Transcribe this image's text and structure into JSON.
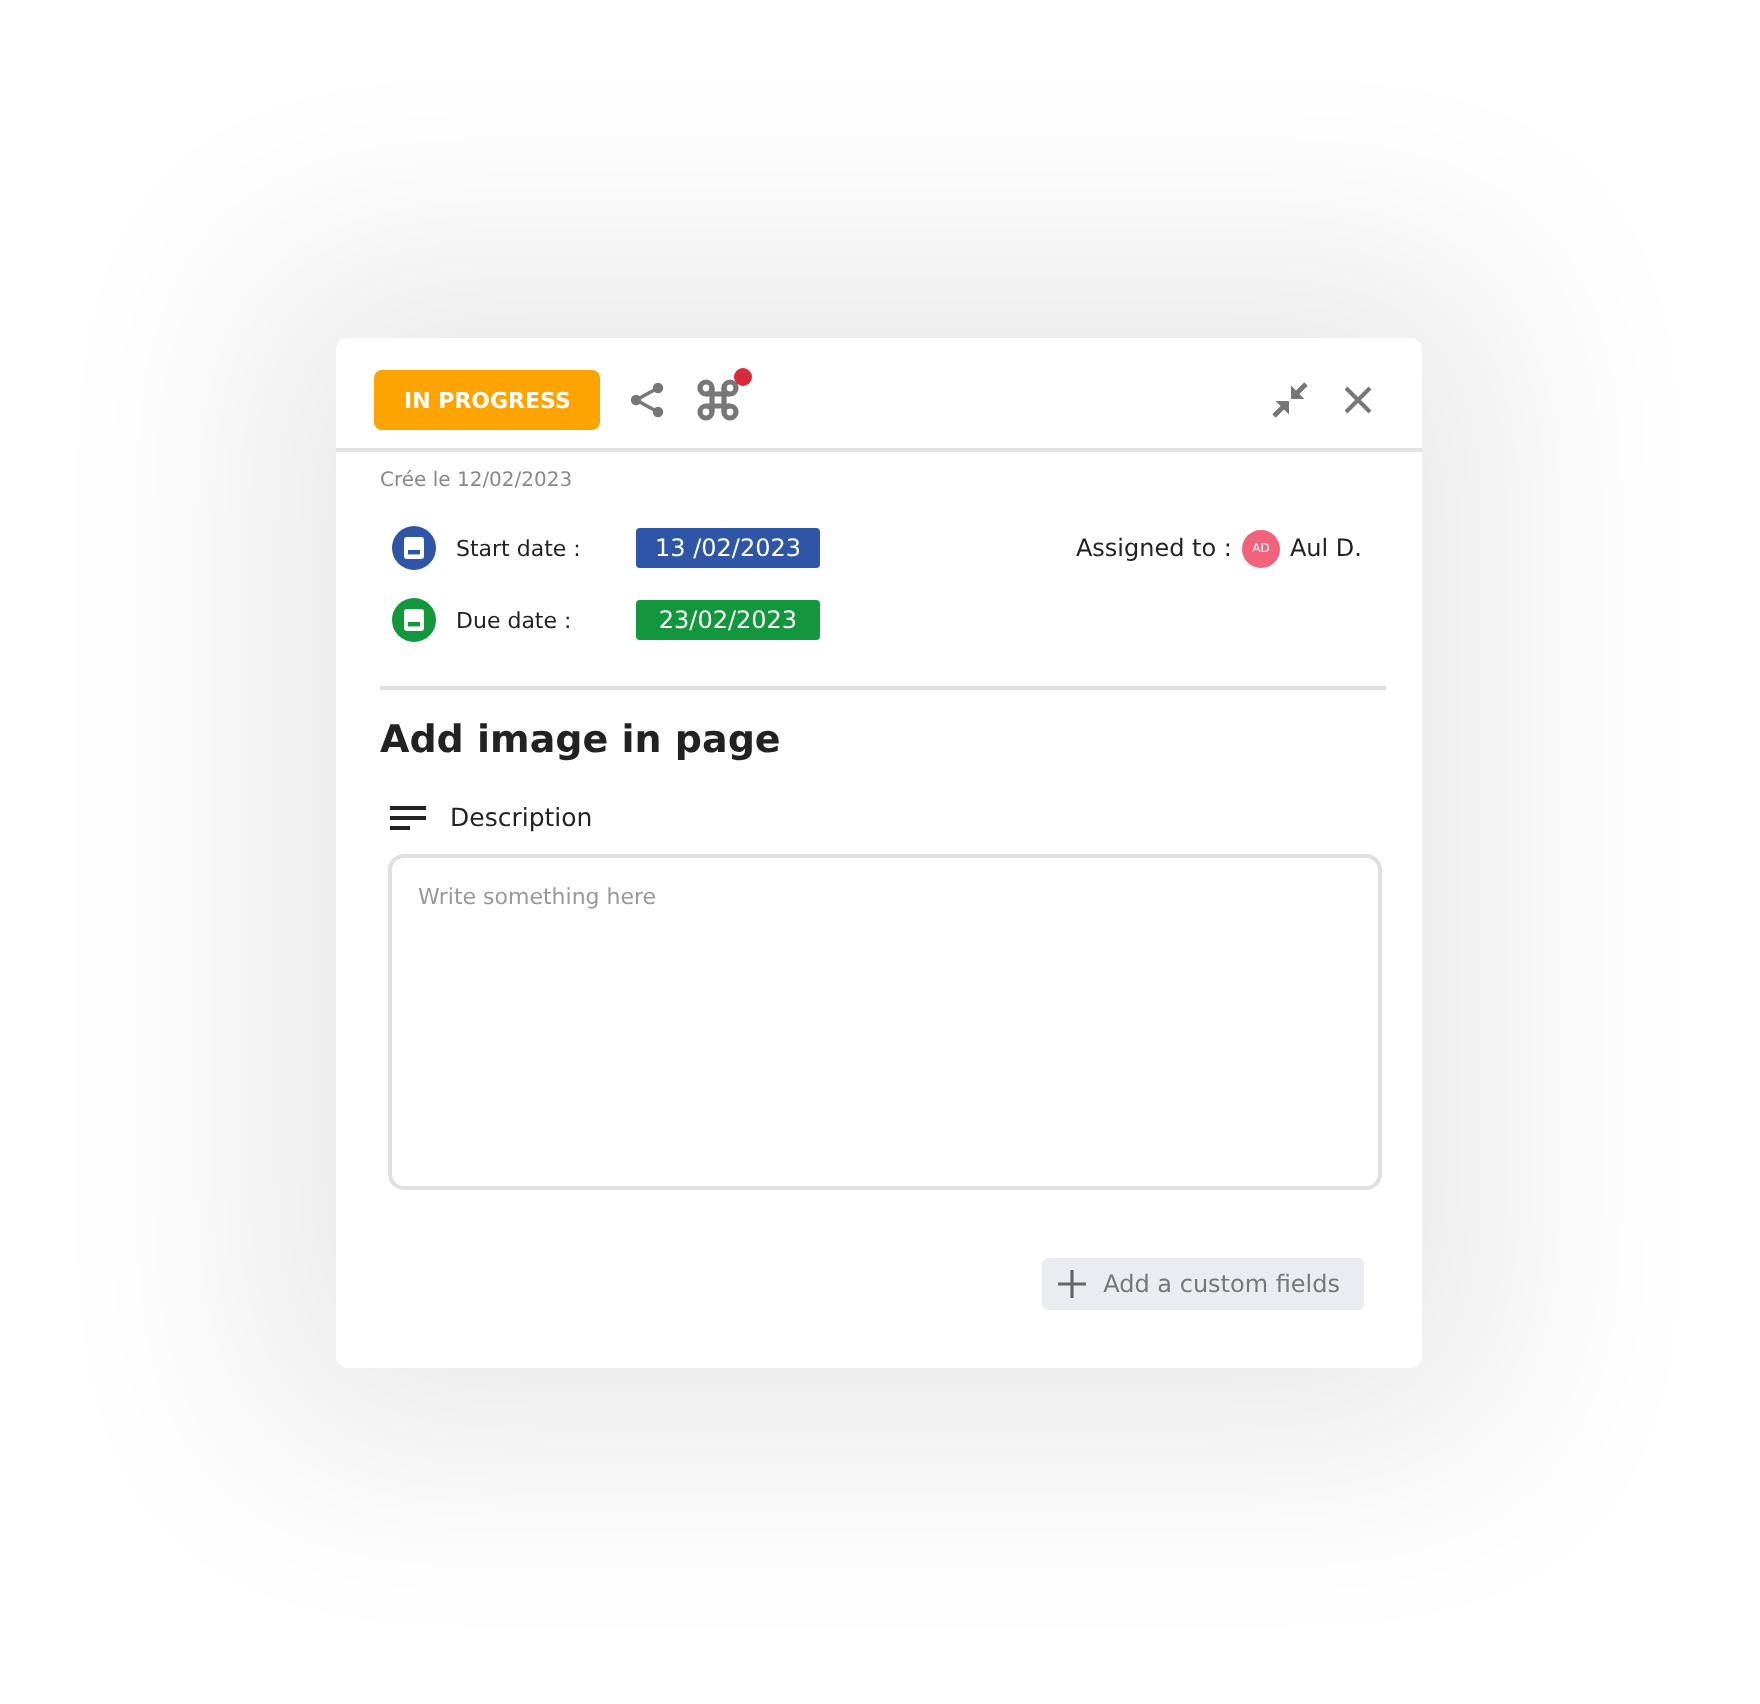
{
  "header": {
    "status": "IN PROGRESS",
    "shortcut_notification": true
  },
  "created": "Crée le 12/02/2023",
  "dates": [
    {
      "label": "Start date :",
      "value": "13 /02/2023",
      "color": "#2f56a6"
    },
    {
      "label": "Due date :",
      "value": "23/02/2023",
      "color": "#12973c"
    }
  ],
  "assigned": {
    "label": "Assigned to :",
    "initials": "AD",
    "name": "Aul D."
  },
  "title": "Add image in page",
  "description": {
    "label": "Description",
    "placeholder": "Write something here"
  },
  "add_field_button": "Add a custom fields"
}
